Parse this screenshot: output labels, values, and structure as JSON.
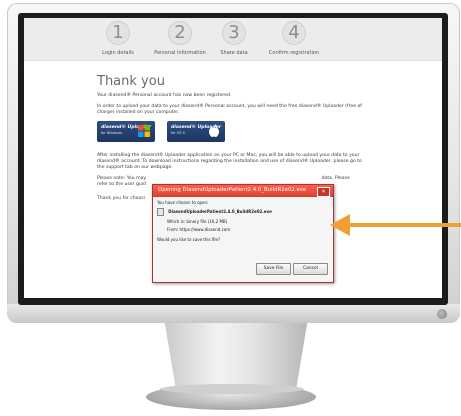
{
  "steps": [
    {
      "number": "1",
      "label": "Login details"
    },
    {
      "number": "2",
      "label": "Personal information"
    },
    {
      "number": "3",
      "label": "Share data"
    },
    {
      "number": "4",
      "label": "Confirm registration"
    }
  ],
  "page": {
    "title": "Thank you",
    "p1": "Your diasend® Personal account has now been registered.",
    "p2": "In order to upload your data to your diasend® Personal account, you will need the free diasend® Uploader (free of charge) installed on your computer.",
    "p3": "After installing the diasend® Uploader application on your PC or Mac, you will be able to upload your data to your diasend® account. To download instructions regarding the installation and use of diasend® Uploader, please go to the support tab on our webpage.",
    "p4a": "Please note: You may",
    "p4b": "data. Please",
    "p4c": "refer to the user guid",
    "p5": "Thank you for choosi"
  },
  "badges": {
    "windows_title": "diasend® Uploader",
    "windows_sub": "for Windows",
    "mac_title": "diasend® Uploader",
    "mac_sub": "for OS X"
  },
  "dialog": {
    "title": "Opening DiasendUploaderPatient2.4.0_BuildR2e02.exe",
    "close": "✕",
    "intro": "You have chosen to open:",
    "filename": "DiasendUploaderPatient2.4.0_BuildR2e02.exe",
    "which": "Which is: binary file (16,2 MB)",
    "from": "From: https://www.diasend.com",
    "question": "Would you like to save this file?",
    "save": "Save File",
    "cancel": "Cancel"
  },
  "colors": {
    "accent": "#f2a036",
    "dialog_title": "#d8412f",
    "badge": "#1d3560"
  }
}
